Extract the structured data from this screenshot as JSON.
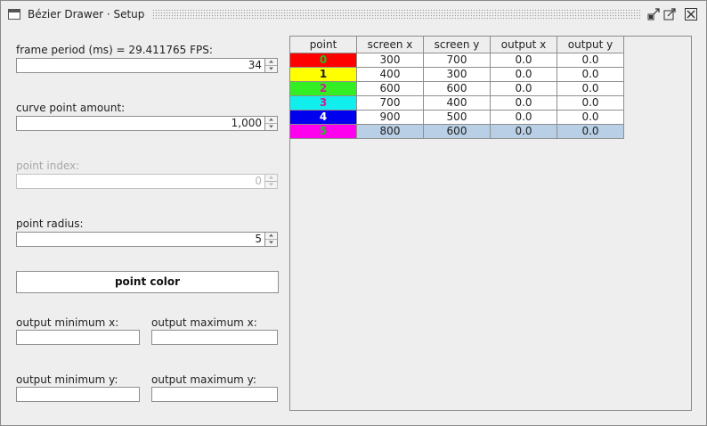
{
  "window": {
    "title": "Bézier Drawer · Setup"
  },
  "settings": {
    "frame_period": {
      "label": "frame period (ms) = 29.411765 FPS:",
      "value": "34"
    },
    "curve_point_amount": {
      "label": "curve point amount:",
      "value": "1,000"
    },
    "point_index": {
      "label": "point index:",
      "value": "0"
    },
    "point_radius": {
      "label": "point radius:",
      "value": "5"
    },
    "point_color_button": "point color",
    "output_min_x": {
      "label": "output minimum x:",
      "value": ""
    },
    "output_max_x": {
      "label": "output maximum x:",
      "value": ""
    },
    "output_min_y": {
      "label": "output minimum y:",
      "value": ""
    },
    "output_max_y": {
      "label": "output maximum y:",
      "value": ""
    }
  },
  "table": {
    "columns": [
      "point",
      "screen x",
      "screen y",
      "output x",
      "output y"
    ],
    "rows": [
      {
        "point": "0",
        "screen_x": "300",
        "screen_y": "700",
        "output_x": "0.0",
        "output_y": "0.0",
        "bg": "#ff0000",
        "fg": "#20c020"
      },
      {
        "point": "1",
        "screen_x": "400",
        "screen_y": "300",
        "output_x": "0.0",
        "output_y": "0.0",
        "bg": "#ffff00",
        "fg": "#202020"
      },
      {
        "point": "2",
        "screen_x": "600",
        "screen_y": "600",
        "output_x": "0.0",
        "output_y": "0.0",
        "bg": "#33ee22",
        "fg": "#d02090"
      },
      {
        "point": "3",
        "screen_x": "700",
        "screen_y": "400",
        "output_x": "0.0",
        "output_y": "0.0",
        "bg": "#11eeee",
        "fg": "#d02090"
      },
      {
        "point": "4",
        "screen_x": "900",
        "screen_y": "500",
        "output_x": "0.0",
        "output_y": "0.0",
        "bg": "#0000ee",
        "fg": "#ffffff"
      },
      {
        "point": "5",
        "screen_x": "800",
        "screen_y": "600",
        "output_x": "0.0",
        "output_y": "0.0",
        "bg": "#ff00ee",
        "fg": "#20c020"
      }
    ],
    "selected_row": 5
  },
  "icons": {
    "window": "window-icon",
    "iconify": "iconify-icon",
    "maximize": "maximize-icon",
    "close": "close-icon",
    "spin_up": "chevron-up-icon",
    "spin_down": "chevron-down-icon"
  }
}
